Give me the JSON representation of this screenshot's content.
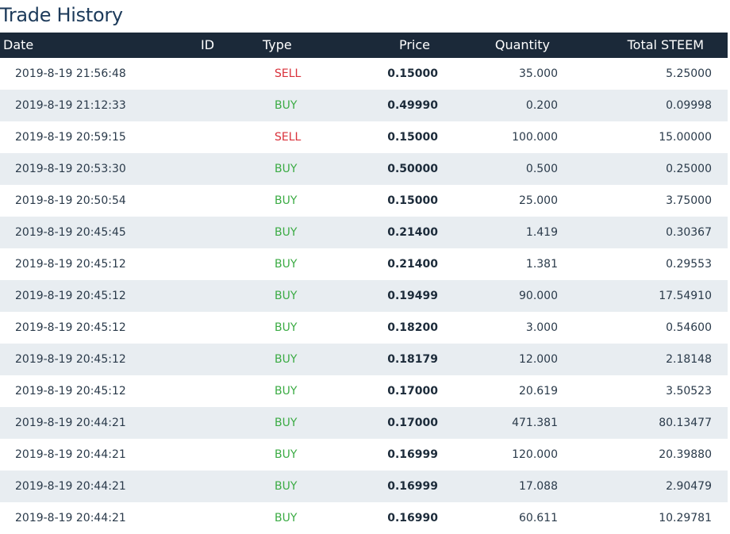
{
  "title": "Trade History",
  "columns": {
    "date": "Date",
    "id": "ID",
    "type": "Type",
    "price": "Price",
    "quantity": "Quantity",
    "total": "Total STEEM"
  },
  "rows": [
    {
      "date": "2019-8-19 21:56:48",
      "type": "SELL",
      "price": "0.15000",
      "quantity": "35.000",
      "total": "5.25000"
    },
    {
      "date": "2019-8-19 21:12:33",
      "type": "BUY",
      "price": "0.49990",
      "quantity": "0.200",
      "total": "0.09998"
    },
    {
      "date": "2019-8-19 20:59:15",
      "type": "SELL",
      "price": "0.15000",
      "quantity": "100.000",
      "total": "15.00000"
    },
    {
      "date": "2019-8-19 20:53:30",
      "type": "BUY",
      "price": "0.50000",
      "quantity": "0.500",
      "total": "0.25000"
    },
    {
      "date": "2019-8-19 20:50:54",
      "type": "BUY",
      "price": "0.15000",
      "quantity": "25.000",
      "total": "3.75000"
    },
    {
      "date": "2019-8-19 20:45:45",
      "type": "BUY",
      "price": "0.21400",
      "quantity": "1.419",
      "total": "0.30367"
    },
    {
      "date": "2019-8-19 20:45:12",
      "type": "BUY",
      "price": "0.21400",
      "quantity": "1.381",
      "total": "0.29553"
    },
    {
      "date": "2019-8-19 20:45:12",
      "type": "BUY",
      "price": "0.19499",
      "quantity": "90.000",
      "total": "17.54910"
    },
    {
      "date": "2019-8-19 20:45:12",
      "type": "BUY",
      "price": "0.18200",
      "quantity": "3.000",
      "total": "0.54600"
    },
    {
      "date": "2019-8-19 20:45:12",
      "type": "BUY",
      "price": "0.18179",
      "quantity": "12.000",
      "total": "2.18148"
    },
    {
      "date": "2019-8-19 20:45:12",
      "type": "BUY",
      "price": "0.17000",
      "quantity": "20.619",
      "total": "3.50523"
    },
    {
      "date": "2019-8-19 20:44:21",
      "type": "BUY",
      "price": "0.17000",
      "quantity": "471.381",
      "total": "80.13477"
    },
    {
      "date": "2019-8-19 20:44:21",
      "type": "BUY",
      "price": "0.16999",
      "quantity": "120.000",
      "total": "20.39880"
    },
    {
      "date": "2019-8-19 20:44:21",
      "type": "BUY",
      "price": "0.16999",
      "quantity": "17.088",
      "total": "2.90479"
    },
    {
      "date": "2019-8-19 20:44:21",
      "type": "BUY",
      "price": "0.16990",
      "quantity": "60.611",
      "total": "10.29781"
    }
  ]
}
